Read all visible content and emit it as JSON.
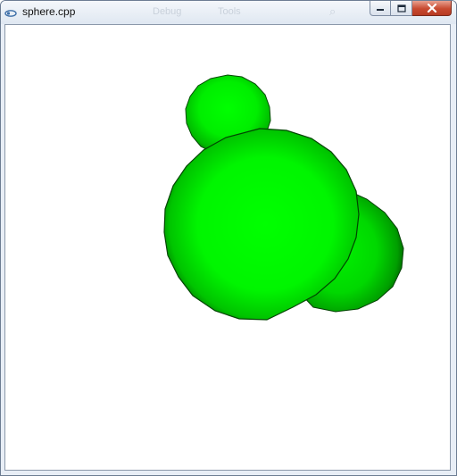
{
  "window": {
    "title": "sphere.cpp",
    "background_menu_ghosts": [
      "Debug",
      "Tools"
    ],
    "icon": "app-icon"
  },
  "controls": {
    "minimize_icon": "minimize-icon",
    "maximize_icon": "maximize-icon",
    "close_icon": "close-icon"
  },
  "scene": {
    "object_count": 3,
    "color": "#00ff00",
    "background": "#ffffff"
  }
}
